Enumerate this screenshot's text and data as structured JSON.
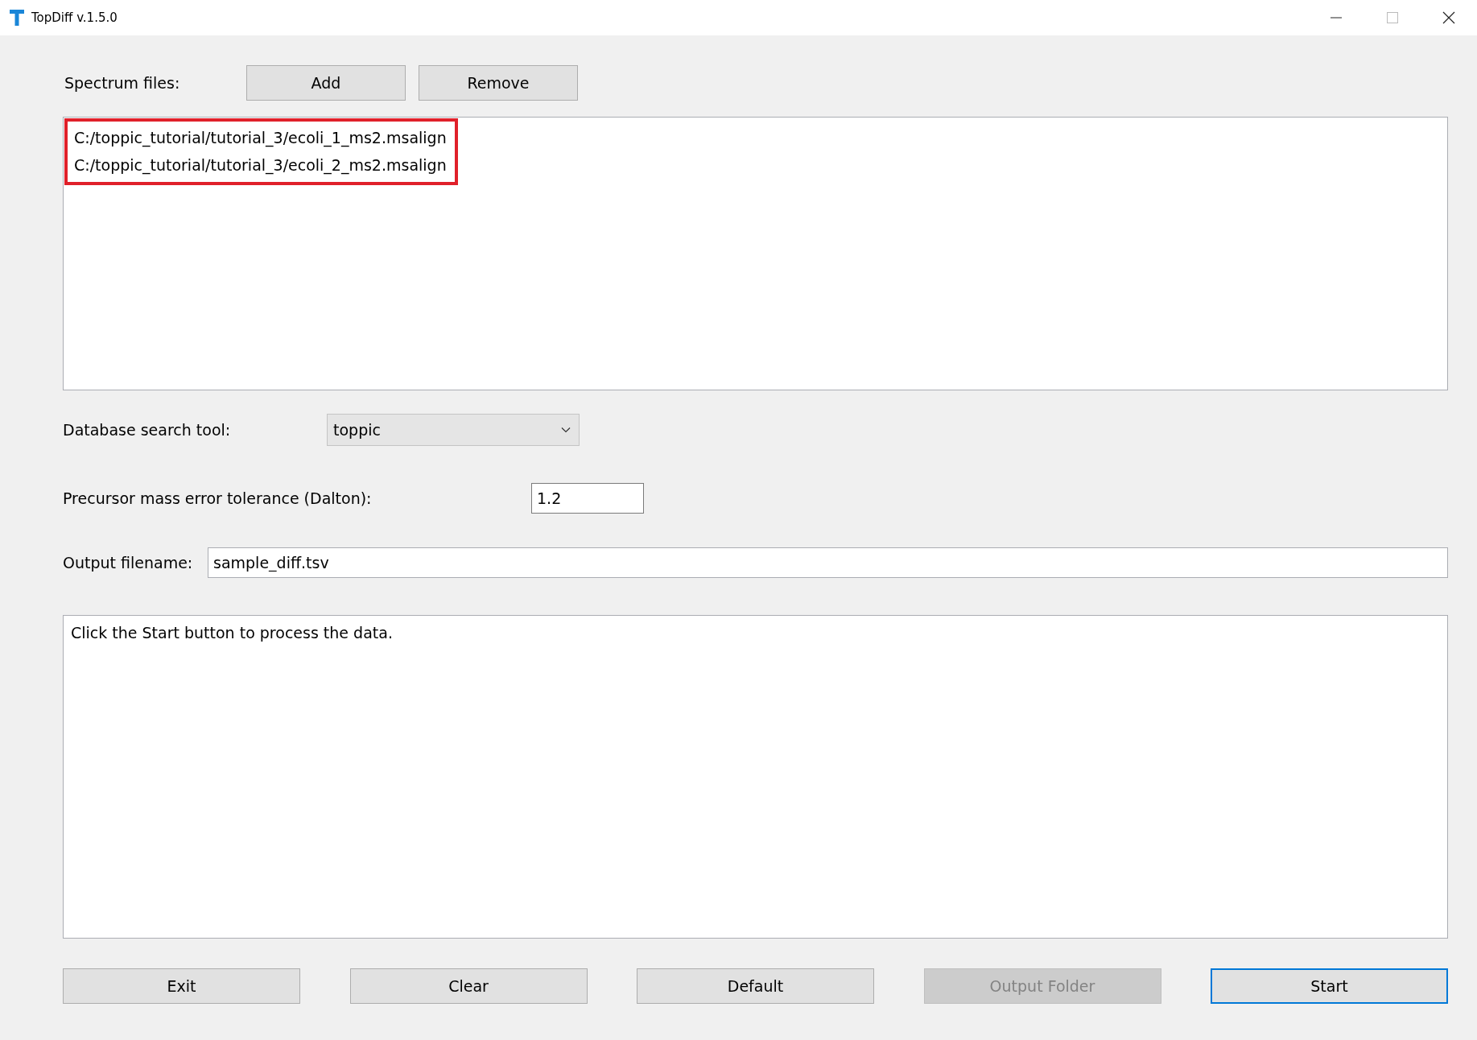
{
  "window": {
    "title": "TopDiff v.1.5.0"
  },
  "spectrum_files": {
    "label": "Spectrum files:",
    "buttons": [
      "Add",
      "Remove"
    ],
    "highlighted": true,
    "items": [
      "C:/toppic_tutorial/tutorial_3/ecoli_1_ms2.msalign",
      "C:/toppic_tutorial/tutorial_3/ecoli_2_ms2.msalign"
    ]
  },
  "database_search_tool": {
    "label": "Database search tool:",
    "value": "toppic"
  },
  "precursor_tolerance": {
    "label": "Precursor mass error tolerance (Dalton):",
    "value": "1.2"
  },
  "output_filename": {
    "label": "Output filename:",
    "value": "sample_diff.tsv"
  },
  "log": {
    "text": "Click the Start button to process the data."
  },
  "buttons": [
    {
      "label": "Exit",
      "disabled": false,
      "focused": false
    },
    {
      "label": "Clear",
      "disabled": false,
      "focused": false
    },
    {
      "label": "Default",
      "disabled": false,
      "focused": false
    },
    {
      "label": "Output Folder",
      "disabled": true,
      "focused": false
    },
    {
      "label": "Start",
      "disabled": false,
      "focused": true
    }
  ]
}
